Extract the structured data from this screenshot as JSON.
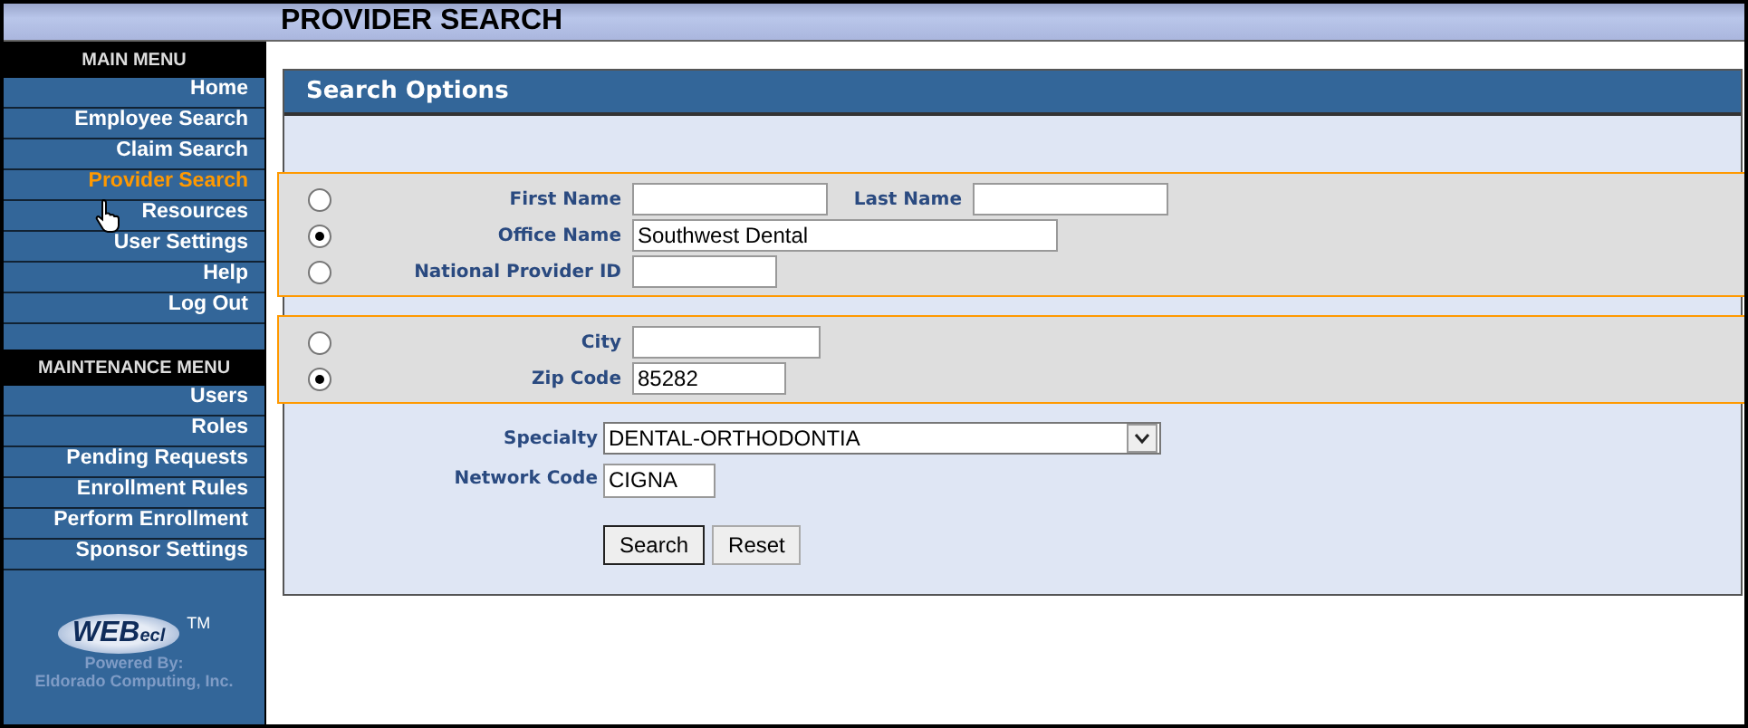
{
  "page_title": "PROVIDER SEARCH",
  "menus": [
    {
      "title": "MAIN MENU",
      "items": [
        {
          "label": "Home",
          "selected": false
        },
        {
          "label": "Employee Search",
          "selected": false
        },
        {
          "label": "Claim Search",
          "selected": false
        },
        {
          "label": "Provider Search",
          "selected": true
        },
        {
          "label": "Resources",
          "selected": false
        },
        {
          "label": "User Settings",
          "selected": false
        },
        {
          "label": "Help",
          "selected": false
        },
        {
          "label": "Log Out",
          "selected": false
        }
      ]
    },
    {
      "title": "MAINTENANCE MENU",
      "items": [
        {
          "label": "Users",
          "selected": false
        },
        {
          "label": "Roles",
          "selected": false
        },
        {
          "label": "Pending Requests",
          "selected": false
        },
        {
          "label": "Enrollment Rules",
          "selected": false
        },
        {
          "label": "Perform Enrollment",
          "selected": false
        },
        {
          "label": "Sponsor Settings",
          "selected": false
        }
      ]
    }
  ],
  "logo": {
    "brand": "WEB",
    "brand_suffix": "ecl",
    "trademark": "TM",
    "powered_by": "Powered By:",
    "company": "Eldorado Computing, Inc."
  },
  "panel": {
    "title": "Search Options",
    "groups": [
      {
        "rows": [
          {
            "selected": false,
            "fields": [
              {
                "label": "First Name"
              },
              {
                "label": "Last Name"
              }
            ]
          },
          {
            "selected": true,
            "fields": [
              {
                "label": "Office Name",
                "value": "Southwest Dental"
              }
            ]
          },
          {
            "selected": false,
            "fields": [
              {
                "label": "National Provider ID"
              }
            ]
          }
        ]
      },
      {
        "rows": [
          {
            "selected": false,
            "fields": [
              {
                "label": "City"
              }
            ]
          },
          {
            "selected": true,
            "fields": [
              {
                "label": "Zip Code",
                "value": "85282"
              }
            ]
          }
        ]
      }
    ],
    "specialty": {
      "label": "Specialty",
      "value": "DENTAL-ORTHODONTIA"
    },
    "network_code": {
      "label": "Network Code",
      "value": "CIGNA"
    },
    "buttons": [
      {
        "label": "Search",
        "focused": true
      },
      {
        "label": "Reset",
        "focused": false
      }
    ]
  }
}
